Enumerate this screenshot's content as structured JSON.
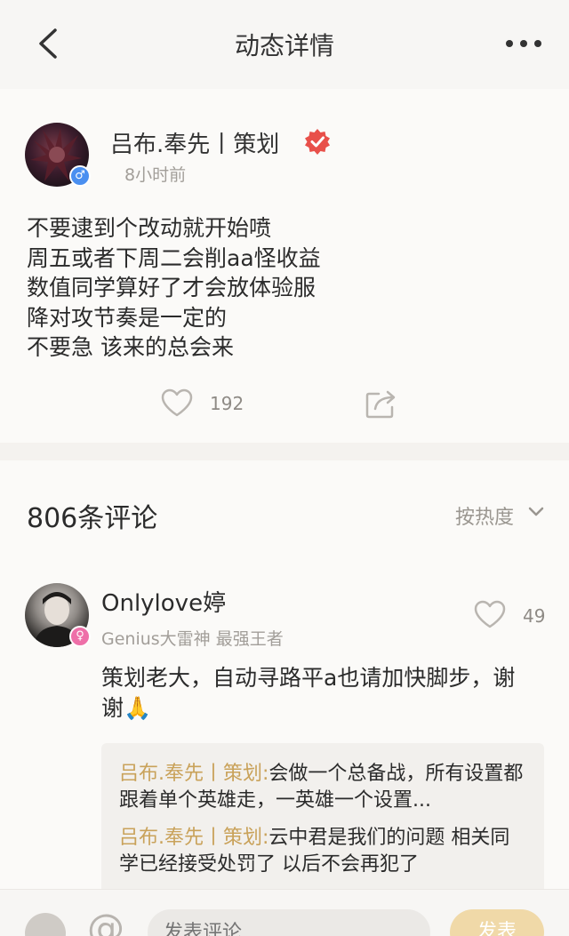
{
  "topbar": {
    "title": "动态详情"
  },
  "post": {
    "author": "吕布.奉先丨策划",
    "time": "8小时前",
    "lines": [
      "不要逮到个改动就开始喷",
      "周五或者下周二会削aa怪收益",
      "数值同学算好了才会放体验服",
      "降对攻节奏是一定的",
      "不要急 该来的总会来"
    ],
    "likes": "192",
    "gender_symbol": "♂"
  },
  "comments": {
    "count_label": "806条评论",
    "sort_label": "按热度",
    "items": [
      {
        "name": "Onlylove婷",
        "tag": "Genius大雷神 最强王者",
        "likes": "49",
        "gender_symbol": "♀",
        "text": "策划老大，自动寻路平a也请加快脚步，谢谢",
        "emoji": "🙏",
        "replies": [
          {
            "who": "吕布.奉先丨策划:",
            "text": "会做一个总备战，所有设置都跟着单个英雄走，一英雄一个设置..."
          },
          {
            "who": "吕布.奉先丨策划:",
            "text": "云中君是我们的问题 相关同学已经接受处罚了 以后不会再犯了"
          }
        ]
      }
    ]
  },
  "bottombar": {
    "input_placeholder": "发表评论",
    "send_label": "发表"
  },
  "colors": {
    "accent": "#c9a25a",
    "male": "#4a8ff0",
    "female": "#ee6fa8",
    "verified": "#e8504a"
  }
}
